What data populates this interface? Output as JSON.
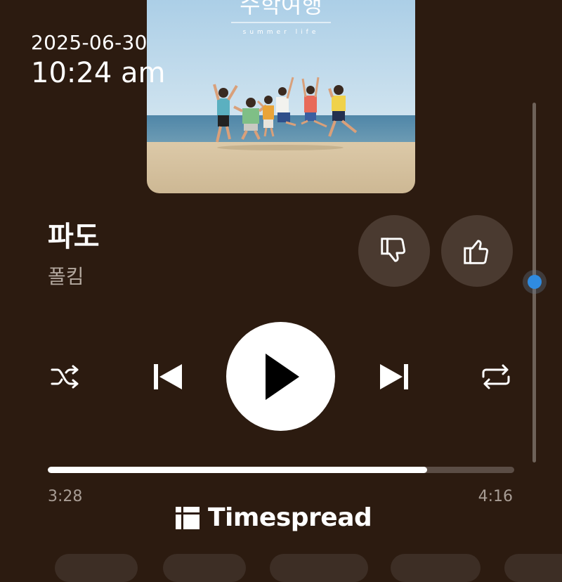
{
  "status": {
    "date": "2025-06-30",
    "time": "10:24 am"
  },
  "album": {
    "title_text": "수학여행",
    "subtitle_text": "summer life"
  },
  "track": {
    "title": "파도",
    "artist": "폴킴",
    "elapsed": "3:28",
    "duration": "4:16",
    "progress_fraction": 0.8125
  },
  "volume": {
    "level_fraction": 0.5
  },
  "controls": {
    "dislike_icon": "thumbs-down-icon",
    "like_icon": "thumbs-up-icon",
    "shuffle_icon": "shuffle-icon",
    "prev_icon": "skip-previous-icon",
    "play_icon": "play-icon",
    "next_icon": "skip-next-icon",
    "repeat_icon": "repeat-icon"
  },
  "watermark": {
    "text": "Timespread"
  },
  "colors": {
    "background": "#2c1b10",
    "accent": "#2f8be0",
    "progress_fill": "#ffffff",
    "button_bg": "#4a3a30"
  }
}
